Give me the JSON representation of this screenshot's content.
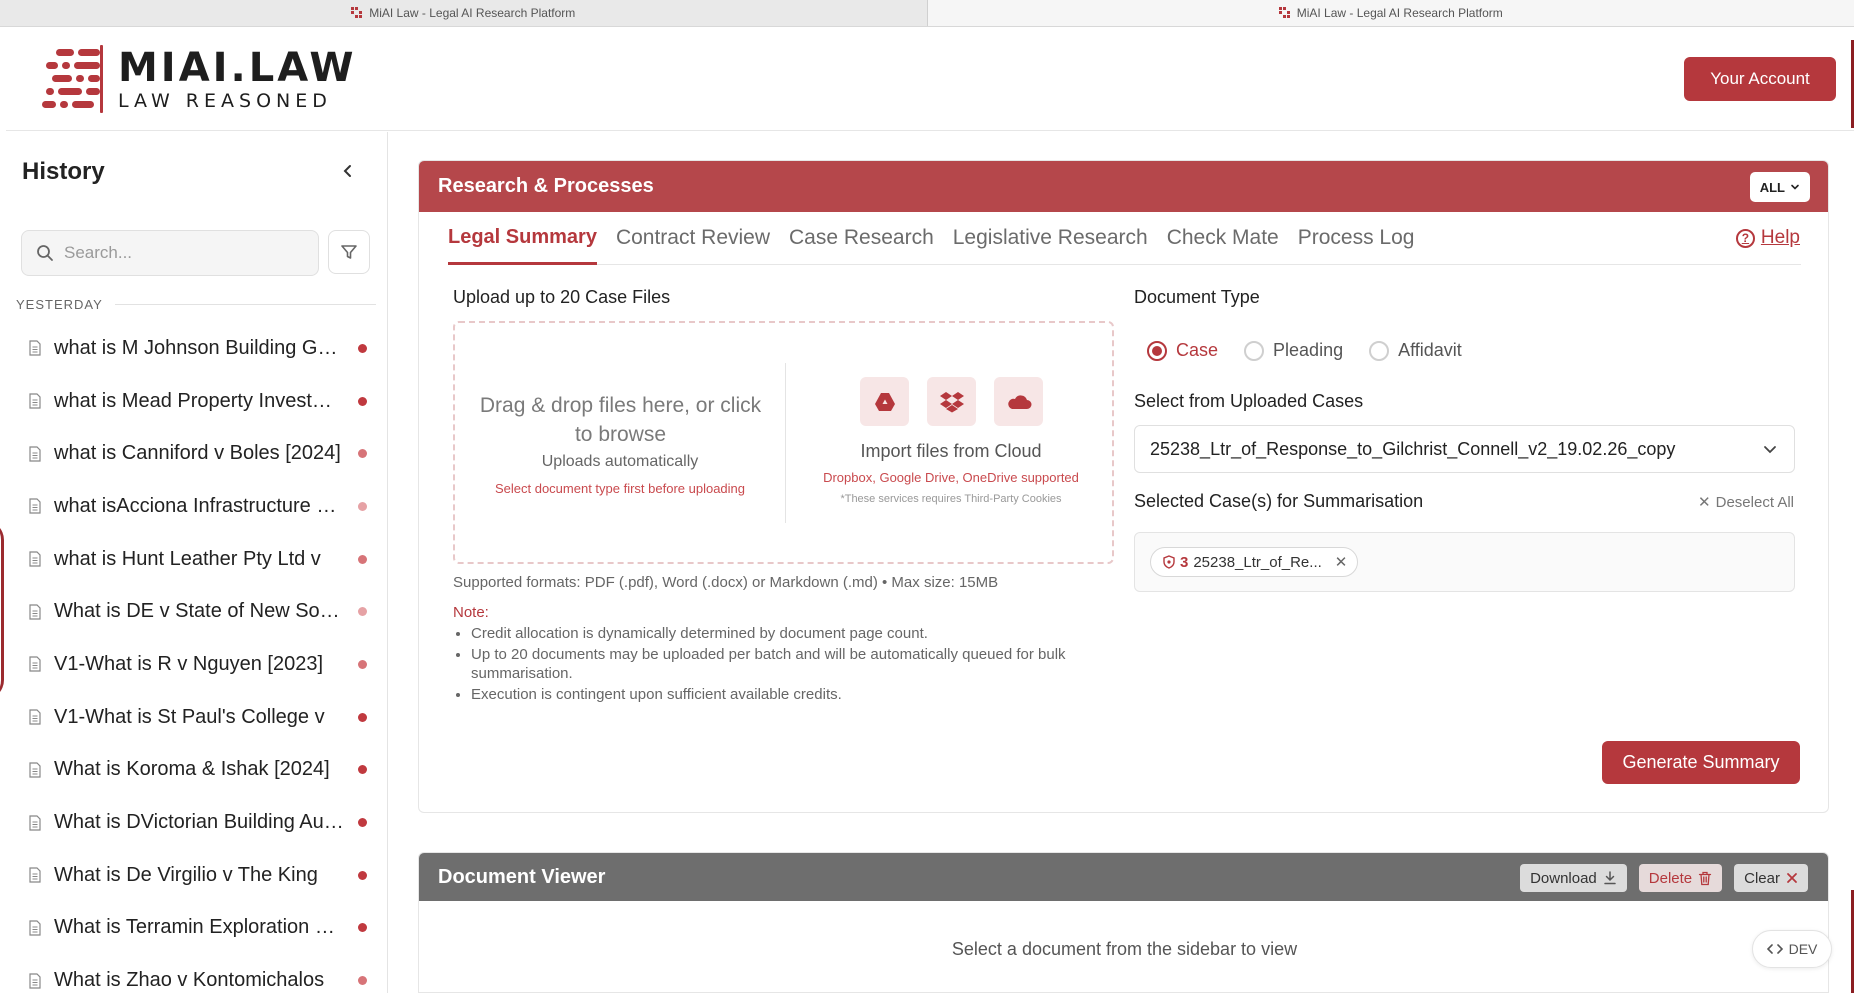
{
  "browser": {
    "tabs": [
      {
        "title": "MiAI Law - Legal AI Research Platform"
      },
      {
        "title": "MiAI Law - Legal AI Research Platform"
      }
    ]
  },
  "brand": {
    "name": "MIAI.LAW",
    "tagline": "LAW REASONED",
    "color": "#b5383d"
  },
  "header": {
    "account_label": "Your Account"
  },
  "sidebar": {
    "title": "History",
    "search_placeholder": "Search...",
    "section": "YESTERDAY",
    "items": [
      {
        "label": "what is M Johnson Building Group Pty Ltd",
        "dot": "#c0393f"
      },
      {
        "label": "what is Mead Property Investments",
        "dot": "#c0393f"
      },
      {
        "label": "what is Canniford v Boles [2024]",
        "dot": "#d77478"
      },
      {
        "label": "what isAcciona Infrastructure Projects",
        "dot": "#e6a2a5"
      },
      {
        "label": "what is Hunt Leather Pty Ltd v",
        "dot": "#d77478"
      },
      {
        "label": "What is DE v State of New South Wales",
        "dot": "#e6a2a5"
      },
      {
        "label": "V1-What is R v Nguyen [2023]",
        "dot": "#d77478"
      },
      {
        "label": "V1-What is St Paul's College v",
        "dot": "#c0393f"
      },
      {
        "label": "What is Koroma & Ishak [2024]",
        "dot": "#c0393f"
      },
      {
        "label": "What is DVictorian Building Authority",
        "dot": "#c0393f"
      },
      {
        "label": "What is De Virgilio v The King",
        "dot": "#c0393f"
      },
      {
        "label": "What is Terramin Exploration Pty Ltd",
        "dot": "#c0393f"
      },
      {
        "label": "What is Zhao v Kontomichalos",
        "dot": "#d77478"
      }
    ]
  },
  "research": {
    "title": "Research & Processes",
    "filter_label": "ALL",
    "tabs": [
      {
        "label": "Legal Summary"
      },
      {
        "label": "Contract Review"
      },
      {
        "label": "Case Research"
      },
      {
        "label": "Legislative Research"
      },
      {
        "label": "Check Mate"
      },
      {
        "label": "Process Log"
      }
    ],
    "help_label": "Help",
    "upload": {
      "title": "Upload up to 20 Case Files",
      "drag_text": "Drag & drop files here, or click to browse",
      "auto_text": "Uploads automatically",
      "warning": "Select document type first before uploading",
      "cloud_title": "Import files from Cloud",
      "cloud_sub": "Dropbox, Google Drive, OneDrive supported",
      "cloud_note": "*These services requires Third-Party Cookies",
      "formats": "Supported formats: PDF (.pdf), Word (.docx) or Markdown (.md) • Max size: 15MB",
      "note_label": "Note:",
      "notes": [
        "Credit allocation is dynamically determined by document page count.",
        "Up to 20 documents may be uploaded per batch and will be automatically queued for bulk summarisation.",
        "Execution is contingent upon sufficient available credits."
      ]
    },
    "doc_type": {
      "title": "Document Type",
      "options": [
        "Case",
        "Pleading",
        "Affidavit"
      ],
      "selected": "Case"
    },
    "select_cases": {
      "title": "Select from Uploaded Cases",
      "value": "25238_Ltr_of_Response_to_Gilchrist_Connell_v2_19.02.26_copy"
    },
    "selected_cases": {
      "title": "Selected Case(s) for Summarisation",
      "deselect_label": "Deselect All",
      "chips": [
        {
          "count": "3",
          "label": "25238_Ltr_of_Re..."
        }
      ]
    },
    "generate_label": "Generate Summary"
  },
  "viewer": {
    "title": "Document Viewer",
    "download_label": "Download",
    "delete_label": "Delete",
    "clear_label": "Clear",
    "empty_text": "Select a document from the sidebar to view"
  },
  "dev_label": "DEV"
}
